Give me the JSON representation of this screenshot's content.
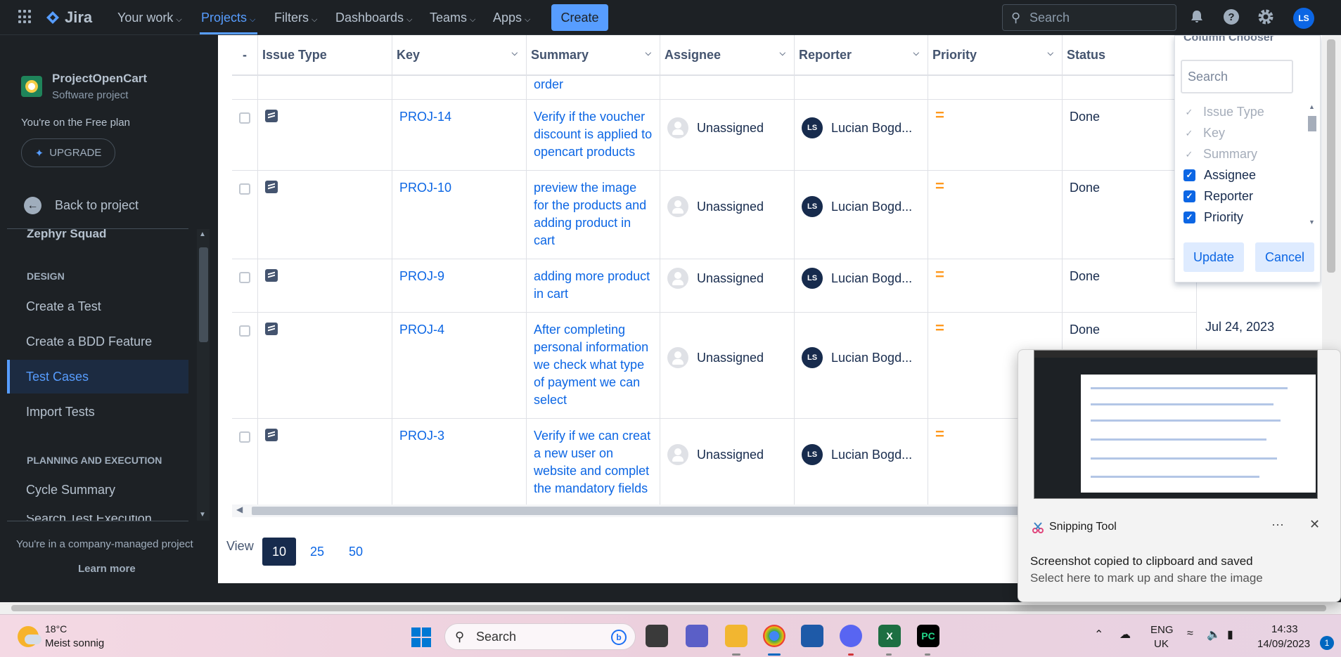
{
  "topnav": {
    "product": "Jira",
    "items": [
      {
        "label": "Your work",
        "active": false
      },
      {
        "label": "Projects",
        "active": true
      },
      {
        "label": "Filters",
        "active": false
      },
      {
        "label": "Dashboards",
        "active": false
      },
      {
        "label": "Teams",
        "active": false
      },
      {
        "label": "Apps",
        "active": false
      }
    ],
    "create_label": "Create",
    "search_placeholder": "Search",
    "user_initials": "LS",
    "icons": [
      "notifications-icon",
      "help-icon",
      "settings-icon"
    ]
  },
  "sidebar": {
    "project_name": "ProjectOpenCart",
    "project_type": "Software project",
    "plan_text": "You're on the Free plan",
    "upgrade_label": "UPGRADE",
    "back_label": "Back to project",
    "plugin_name": "Zephyr Squad",
    "design_heading": "DESIGN",
    "design_items": [
      "Create a Test",
      "Create a BDD Feature",
      "Test Cases",
      "Import Tests"
    ],
    "selected_item": "Test Cases",
    "planning_heading": "PLANNING AND EXECUTION",
    "planning_items": [
      "Cycle Summary",
      "Search Test Execution"
    ],
    "footer_text": "You're in a company-managed project",
    "learn_more": "Learn more"
  },
  "table": {
    "columns": [
      "-",
      "Issue Type",
      "Key",
      "Summary",
      "Assignee",
      "Reporter",
      "Priority",
      "Status"
    ],
    "partial_row_summary": "order",
    "rows": [
      {
        "key": "PROJ-14",
        "summary": "Verify if the voucher discount is applied to opencart products",
        "assignee": "Unassigned",
        "reporter_initials": "LS",
        "reporter": "Lucian Bogd...",
        "priority": "=",
        "status": "Done",
        "date": ""
      },
      {
        "key": "PROJ-10",
        "summary": "preview the image for the products and adding product in cart",
        "assignee": "Unassigned",
        "reporter_initials": "LS",
        "reporter": "Lucian Bogd...",
        "priority": "=",
        "status": "Done",
        "date": ""
      },
      {
        "key": "PROJ-9",
        "summary": "adding more product in cart",
        "assignee": "Unassigned",
        "reporter_initials": "LS",
        "reporter": "Lucian Bogd...",
        "priority": "=",
        "status": "Done",
        "date": ""
      },
      {
        "key": "PROJ-4",
        "summary": "After completing personal information we check what type of payment we can select",
        "assignee": "Unassigned",
        "reporter_initials": "LS",
        "reporter": "Lucian Bogd...",
        "priority": "=",
        "status": "Done",
        "date": "Jul 24, 2023"
      },
      {
        "key": "PROJ-3",
        "summary": "Verify if we can creat a new user on website and complet the mandatory fields",
        "assignee": "Unassigned",
        "reporter_initials": "LS",
        "reporter": "Lucian Bogd...",
        "priority": "=",
        "status": "",
        "date": ""
      }
    ]
  },
  "pagination": {
    "view_label": "View",
    "options": [
      "10",
      "25",
      "50"
    ],
    "selected": "10"
  },
  "column_chooser": {
    "title": "Column Chooser",
    "search_placeholder": "Search",
    "items": [
      {
        "label": "Issue Type",
        "checked": true,
        "disabled": true
      },
      {
        "label": "Key",
        "checked": true,
        "disabled": true
      },
      {
        "label": "Summary",
        "checked": true,
        "disabled": true
      },
      {
        "label": "Assignee",
        "checked": true,
        "disabled": false
      },
      {
        "label": "Reporter",
        "checked": true,
        "disabled": false
      },
      {
        "label": "Priority",
        "checked": true,
        "disabled": false
      }
    ],
    "update_label": "Update",
    "cancel_label": "Cancel"
  },
  "toast": {
    "app_name": "Snipping Tool",
    "more_label": "···",
    "close_label": "✕",
    "message": "Screenshot copied to clipboard and saved",
    "sub_message": "Select here to mark up and share the image"
  },
  "taskbar": {
    "temperature": "18°C",
    "weather": "Meist sonnig",
    "search_placeholder": "Search",
    "language": "ENG",
    "region": "UK",
    "time": "14:33",
    "date": "14/09/2023",
    "notification_count": "1"
  },
  "colors": {
    "accent": "#579dff",
    "link": "#0c66e4",
    "priority_medium": "#ff991f",
    "sidebar_bg": "#1d2125"
  }
}
